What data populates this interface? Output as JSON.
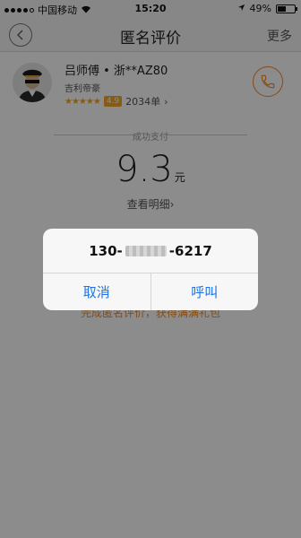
{
  "status_bar": {
    "carrier": "中国移动",
    "time": "15:20",
    "battery": "49%",
    "battery_level": 0.49
  },
  "nav": {
    "title": "匿名评价",
    "more": "更多"
  },
  "driver": {
    "name": "吕师傅 • 浙**AZ80",
    "company": "吉利帝豪",
    "stars": "★★★★★",
    "score": "4.9",
    "orders": "2034单",
    "orders_chevron": "›"
  },
  "payment": {
    "status": "成功支付",
    "amount": "9.3",
    "unit": "元",
    "detail_link": "查看明细›"
  },
  "promo": "完成匿名评价，获得满满礼包",
  "dialog": {
    "phone_prefix": "130-",
    "phone_suffix": "-6217",
    "cancel": "取消",
    "call": "呼叫"
  },
  "colors": {
    "accent": "#f08a24",
    "link_blue": "#1a73e8",
    "overlay": "rgba(0,0,0,0.45)"
  }
}
